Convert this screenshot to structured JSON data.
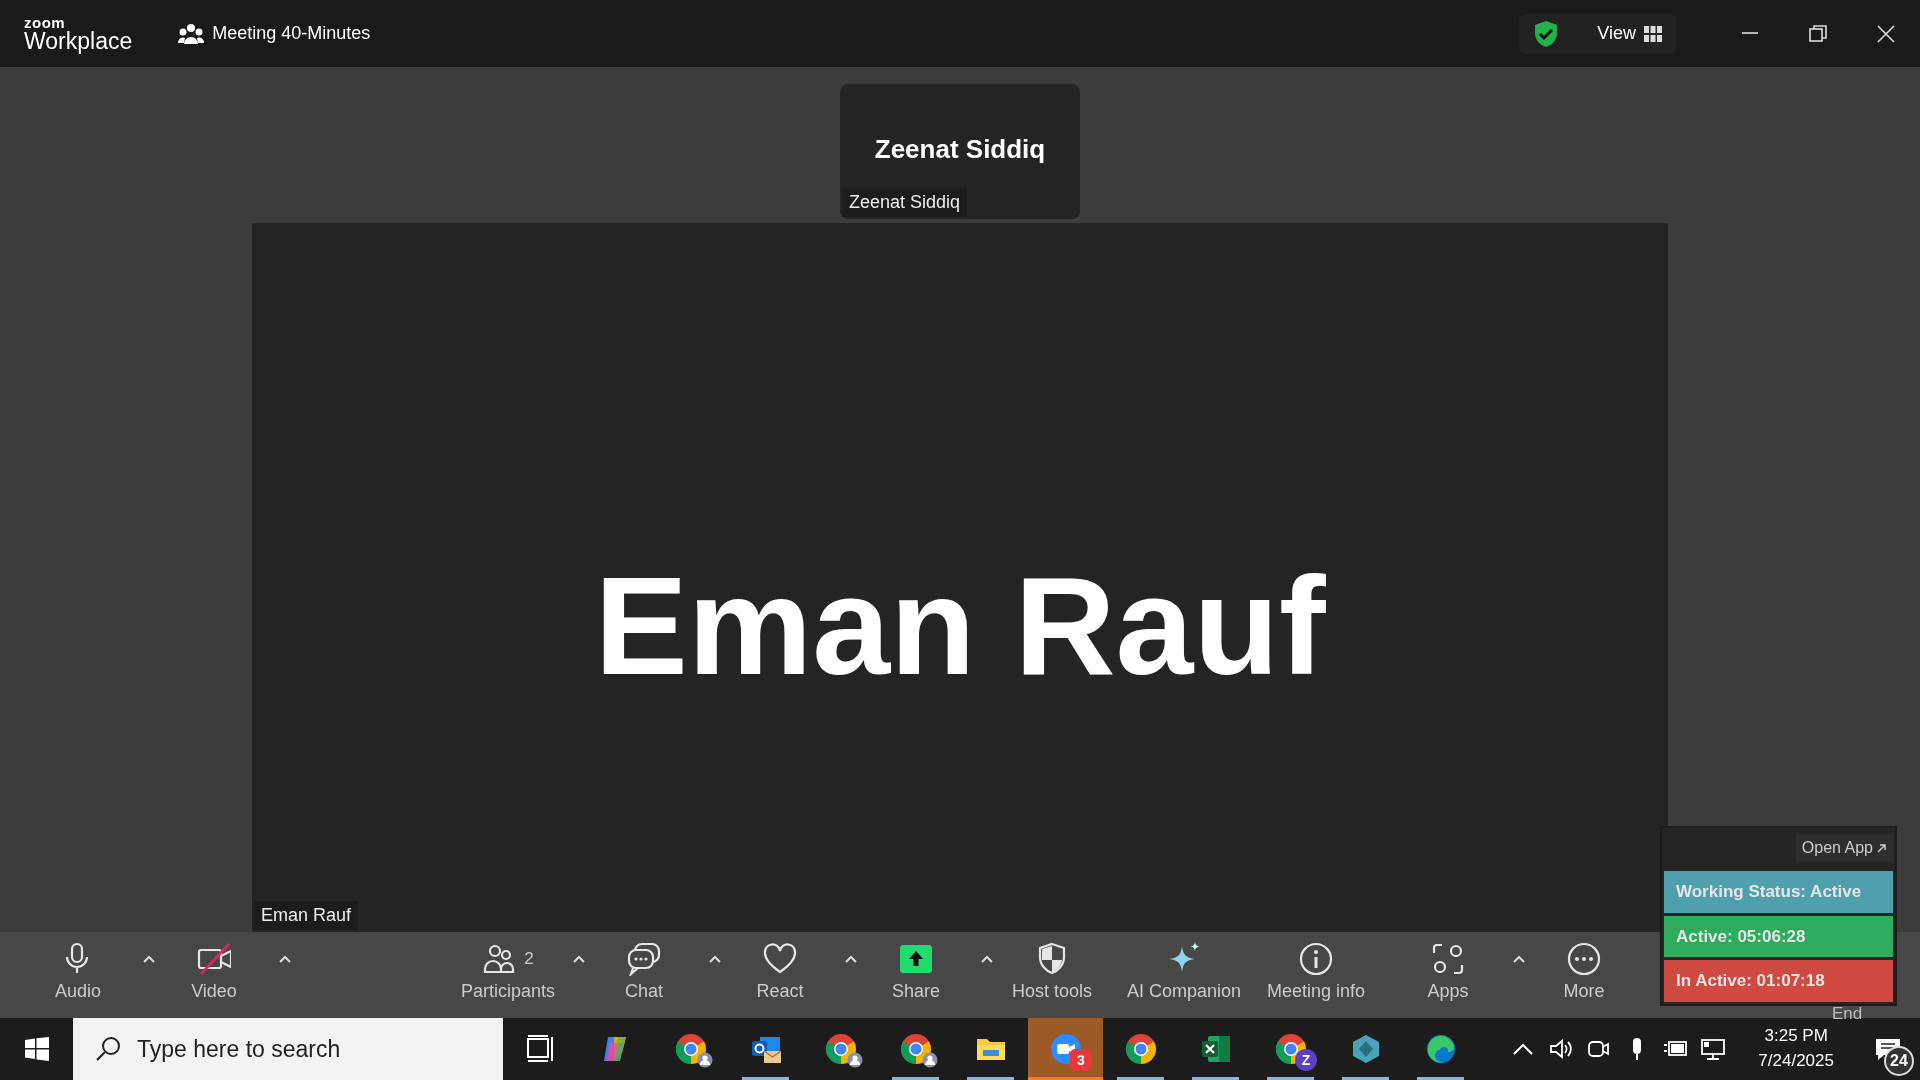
{
  "title_bar": {
    "logo_top": "zoom",
    "logo_bottom": "Workplace",
    "meeting_title": "Meeting 40-Minutes",
    "view_button": "View"
  },
  "tiles": [
    {
      "kind": "thumbnail",
      "display_name": "Zeenat Siddiq",
      "name_label": "Zeenat Siddiq"
    },
    {
      "kind": "main",
      "display_name": "Eman Rauf",
      "name_label": "Eman Rauf"
    }
  ],
  "toolbar_left": [
    {
      "kind": "audio",
      "label": "Audio",
      "off": false,
      "caret": true
    },
    {
      "kind": "video",
      "label": "Video",
      "off": true,
      "caret": true
    }
  ],
  "toolbar_center": [
    {
      "kind": "participants",
      "label": "Participants",
      "count": "2",
      "caret": true
    },
    {
      "kind": "chat",
      "label": "Chat",
      "caret": true
    },
    {
      "kind": "react",
      "label": "React",
      "caret": true
    },
    {
      "kind": "share",
      "label": "Share",
      "caret": true
    },
    {
      "kind": "host",
      "label": "Host tools",
      "caret": false
    },
    {
      "kind": "ai",
      "label": "AI Companion",
      "caret": false
    },
    {
      "kind": "info",
      "label": "Meeting info",
      "caret": false
    },
    {
      "kind": "apps",
      "label": "Apps",
      "caret": true
    },
    {
      "kind": "more",
      "label": "More",
      "caret": false
    }
  ],
  "end_button": {
    "label": "End"
  },
  "status_widget": {
    "open_app": "Open App",
    "rows": [
      {
        "text": "Working Status: Active",
        "color": "#4f9fae"
      },
      {
        "text": "Active: 05:06:28",
        "color": "#2eab5e"
      },
      {
        "text": "In Active: 01:07:18",
        "color": "#cf4a40"
      }
    ]
  },
  "taskbar": {
    "search_placeholder": "Type here to search",
    "apps": [
      {
        "kind": "taskview",
        "running": false,
        "selected": false
      },
      {
        "kind": "copilot",
        "running": false,
        "selected": false
      },
      {
        "kind": "chrome_profile",
        "running": false,
        "selected": false
      },
      {
        "kind": "outlook",
        "running": true,
        "selected": false
      },
      {
        "kind": "chrome_profile",
        "running": false,
        "selected": false
      },
      {
        "kind": "chrome_profile",
        "running": true,
        "selected": false
      },
      {
        "kind": "explorer",
        "running": true,
        "selected": false
      },
      {
        "kind": "zoom",
        "running": true,
        "selected": true,
        "count": "3"
      },
      {
        "kind": "chrome",
        "running": true,
        "selected": false
      },
      {
        "kind": "excel",
        "running": true,
        "selected": false
      },
      {
        "kind": "chrome",
        "running": true,
        "selected": false,
        "letter": "Z"
      },
      {
        "kind": "cube",
        "running": true,
        "selected": false
      },
      {
        "kind": "edge",
        "running": true,
        "selected": false
      }
    ],
    "time": "3:25 PM",
    "date": "7/24/2025",
    "notifications": "24"
  }
}
